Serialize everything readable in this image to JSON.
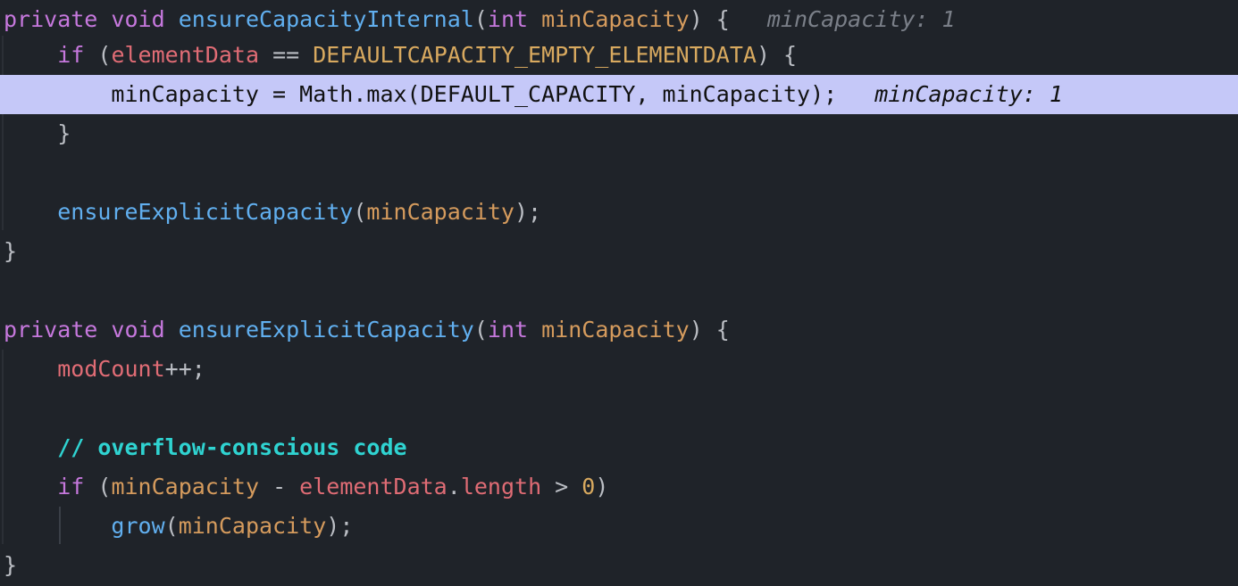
{
  "editor": {
    "lines": [
      {
        "tokens": [
          {
            "t": "private",
            "c": "kw"
          },
          {
            "t": " ",
            "c": "punct"
          },
          {
            "t": "void",
            "c": "kw"
          },
          {
            "t": " ",
            "c": "punct"
          },
          {
            "t": "ensureCapacityInternal",
            "c": "fn"
          },
          {
            "t": "(",
            "c": "punct"
          },
          {
            "t": "int",
            "c": "type"
          },
          {
            "t": " ",
            "c": "punct"
          },
          {
            "t": "minCapacity",
            "c": "param"
          },
          {
            "t": ") {",
            "c": "punct"
          }
        ],
        "hint": "minCapacity: 1"
      },
      {
        "tokens": [
          {
            "t": "    ",
            "c": "punct"
          },
          {
            "t": "if",
            "c": "kw"
          },
          {
            "t": " (",
            "c": "punct"
          },
          {
            "t": "elementData",
            "c": "field"
          },
          {
            "t": " == ",
            "c": "op"
          },
          {
            "t": "DEFAULTCAPACITY_EMPTY_ELEMENTDATA",
            "c": "const"
          },
          {
            "t": ") {",
            "c": "punct"
          }
        ],
        "hint": ""
      },
      {
        "tokens": [
          {
            "t": "        ",
            "c": "punct"
          },
          {
            "t": "minCapacity = Math.max(DEFAULT_CAPACITY, minCapacity);",
            "c": "punct"
          }
        ],
        "hint": "minCapacity: 1",
        "highlighted": true
      },
      {
        "tokens": [
          {
            "t": "    ",
            "c": "punct"
          },
          {
            "t": "}",
            "c": "punct"
          }
        ],
        "hint": ""
      },
      {
        "tokens": [],
        "hint": ""
      },
      {
        "tokens": [
          {
            "t": "    ",
            "c": "punct"
          },
          {
            "t": "ensureExplicitCapacity",
            "c": "fn"
          },
          {
            "t": "(",
            "c": "punct"
          },
          {
            "t": "minCapacity",
            "c": "param"
          },
          {
            "t": ");",
            "c": "punct"
          }
        ],
        "hint": ""
      },
      {
        "tokens": [
          {
            "t": "}",
            "c": "punct"
          }
        ],
        "hint": ""
      },
      {
        "tokens": [],
        "hint": ""
      },
      {
        "tokens": [
          {
            "t": "private",
            "c": "kw"
          },
          {
            "t": " ",
            "c": "punct"
          },
          {
            "t": "void",
            "c": "kw"
          },
          {
            "t": " ",
            "c": "punct"
          },
          {
            "t": "ensureExplicitCapacity",
            "c": "fn"
          },
          {
            "t": "(",
            "c": "punct"
          },
          {
            "t": "int",
            "c": "type"
          },
          {
            "t": " ",
            "c": "punct"
          },
          {
            "t": "minCapacity",
            "c": "param"
          },
          {
            "t": ") {",
            "c": "punct"
          }
        ],
        "hint": ""
      },
      {
        "tokens": [
          {
            "t": "    ",
            "c": "punct"
          },
          {
            "t": "modCount",
            "c": "field"
          },
          {
            "t": "++;",
            "c": "punct"
          }
        ],
        "hint": ""
      },
      {
        "tokens": [],
        "hint": ""
      },
      {
        "tokens": [
          {
            "t": "    ",
            "c": "punct"
          },
          {
            "t": "// overflow-conscious code",
            "c": "comment"
          }
        ],
        "hint": ""
      },
      {
        "tokens": [
          {
            "t": "    ",
            "c": "punct"
          },
          {
            "t": "if",
            "c": "kw"
          },
          {
            "t": " (",
            "c": "punct"
          },
          {
            "t": "minCapacity",
            "c": "param"
          },
          {
            "t": " - ",
            "c": "op"
          },
          {
            "t": "elementData",
            "c": "field"
          },
          {
            "t": ".",
            "c": "punct"
          },
          {
            "t": "length",
            "c": "field"
          },
          {
            "t": " > ",
            "c": "op"
          },
          {
            "t": "0",
            "c": "num"
          },
          {
            "t": ")",
            "c": "punct"
          }
        ],
        "hint": ""
      },
      {
        "tokens": [
          {
            "t": "        ",
            "c": "punct"
          },
          {
            "t": "grow",
            "c": "fn"
          },
          {
            "t": "(",
            "c": "punct"
          },
          {
            "t": "minCapacity",
            "c": "param"
          },
          {
            "t": ");",
            "c": "punct"
          }
        ],
        "hint": ""
      },
      {
        "tokens": [
          {
            "t": "}",
            "c": "punct"
          }
        ],
        "hint": ""
      }
    ]
  }
}
